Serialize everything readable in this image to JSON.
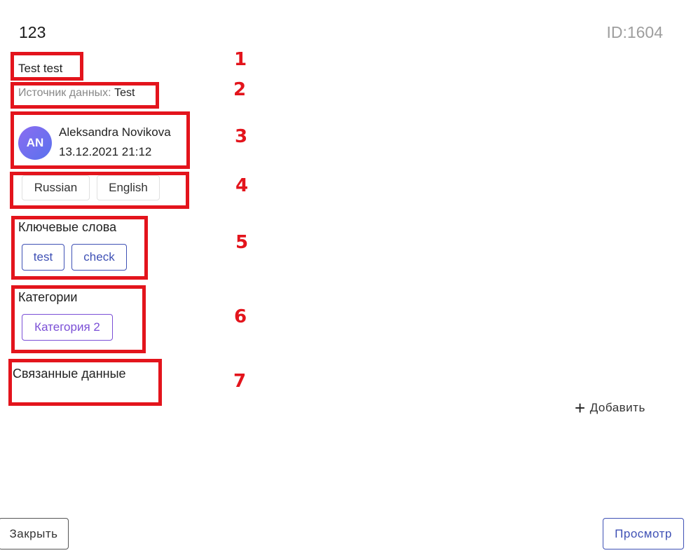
{
  "header": {
    "title": "123",
    "id_label": "ID:1604"
  },
  "item": {
    "name": "Test test",
    "source_label": "Источник данных:",
    "source_value": "Test",
    "author": {
      "initials": "AN",
      "name": "Aleksandra Novikova",
      "date": "13.12.2021 21:12"
    },
    "languages": [
      "Russian",
      "English"
    ],
    "keywords_title": "Ключевые слова",
    "keywords": [
      "test",
      "check"
    ],
    "categories_title": "Категории",
    "categories": [
      "Категория 2"
    ],
    "related_title": "Связанные данные",
    "add_label": "Добавить"
  },
  "annotations": [
    "1",
    "2",
    "3",
    "4",
    "5",
    "6",
    "7"
  ],
  "footer": {
    "close_label": "Закрыть",
    "preview_label": "Просмотр"
  },
  "colors": {
    "annotation": "#e3141c",
    "primary": "#3f51b5",
    "category": "#7b4fd6"
  }
}
